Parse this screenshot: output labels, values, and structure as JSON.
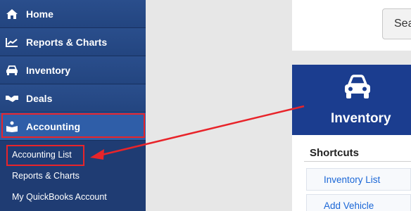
{
  "sidebar": {
    "items": [
      {
        "label": "Home",
        "icon": "home-icon"
      },
      {
        "label": "Reports & Charts",
        "icon": "chart-line-icon"
      },
      {
        "label": "Inventory",
        "icon": "car-icon"
      },
      {
        "label": "Deals",
        "icon": "handshake-icon"
      },
      {
        "label": "Accounting",
        "icon": "book-reader-icon"
      }
    ],
    "subitems": [
      {
        "label": "Accounting List"
      },
      {
        "label": "Reports & Charts"
      },
      {
        "label": "My QuickBooks Account"
      }
    ]
  },
  "search": {
    "label": "Sea"
  },
  "inventory_card": {
    "title": "Inventory",
    "icon": "car-icon"
  },
  "shortcuts": {
    "title": "Shortcuts",
    "links": [
      {
        "label": "Inventory List"
      },
      {
        "label": "Add Vehicle"
      }
    ]
  },
  "colors": {
    "sidebar": "#1f3c73",
    "annotation": "#e8242a",
    "card_header": "#1b3d8f",
    "link": "#1a66d6"
  }
}
